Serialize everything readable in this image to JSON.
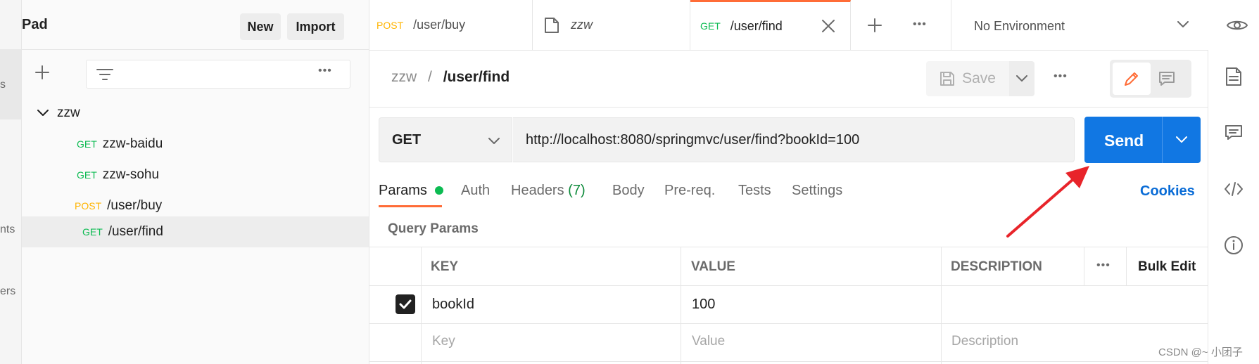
{
  "left_rail": {
    "label_1": "s",
    "label_2": "nts",
    "label_3": "ers"
  },
  "sidebar": {
    "workspace_name": "Pad",
    "new_label": "New",
    "import_label": "Import",
    "tree": {
      "collection": "zzw",
      "items": [
        {
          "method": "GET",
          "name": "zzw-baidu"
        },
        {
          "method": "GET",
          "name": "zzw-sohu"
        },
        {
          "method": "POST",
          "name": "/user/buy"
        },
        {
          "method": "GET",
          "name": "/user/find",
          "selected": true
        }
      ]
    }
  },
  "tabs": [
    {
      "method": "POST",
      "title": "/user/buy"
    },
    {
      "method": "",
      "title": "zzw"
    },
    {
      "method": "GET",
      "title": "/user/find",
      "active": true
    }
  ],
  "environment": {
    "selected": "No Environment"
  },
  "request": {
    "breadcrumb_collection": "zzw",
    "breadcrumb_sep": "/",
    "breadcrumb_name": "/user/find",
    "save_label": "Save",
    "method": "GET",
    "url": "http://localhost:8080/springmvc/user/find?bookId=100",
    "send_label": "Send"
  },
  "request_tabs": {
    "params": "Params",
    "auth": "Auth",
    "headers": "Headers",
    "headers_count": "(7)",
    "body": "Body",
    "prereq": "Pre-req.",
    "tests": "Tests",
    "settings": "Settings",
    "cookies": "Cookies"
  },
  "params": {
    "title": "Query Params",
    "columns": {
      "key": "KEY",
      "value": "VALUE",
      "description": "DESCRIPTION",
      "bulk_edit": "Bulk Edit"
    },
    "rows": [
      {
        "key": "bookId",
        "value": "100",
        "description": "",
        "checked": true
      }
    ],
    "placeholders": {
      "key": "Key",
      "value": "Value",
      "description": "Description"
    }
  },
  "watermark": "CSDN @~ 小团子",
  "colors": {
    "accent": "#ff6c37",
    "send": "#1177e3",
    "get": "#0cbb52",
    "post": "#ffb400",
    "link": "#0a6cd6",
    "arrow": "#e8242a"
  },
  "icons": [
    "plus-icon",
    "filter-icon",
    "more-icon",
    "chevron-down-icon",
    "document-icon",
    "close-icon",
    "eye-icon",
    "save-icon",
    "pencil-icon",
    "comment-icon",
    "code-icon",
    "info-icon",
    "check-icon"
  ]
}
